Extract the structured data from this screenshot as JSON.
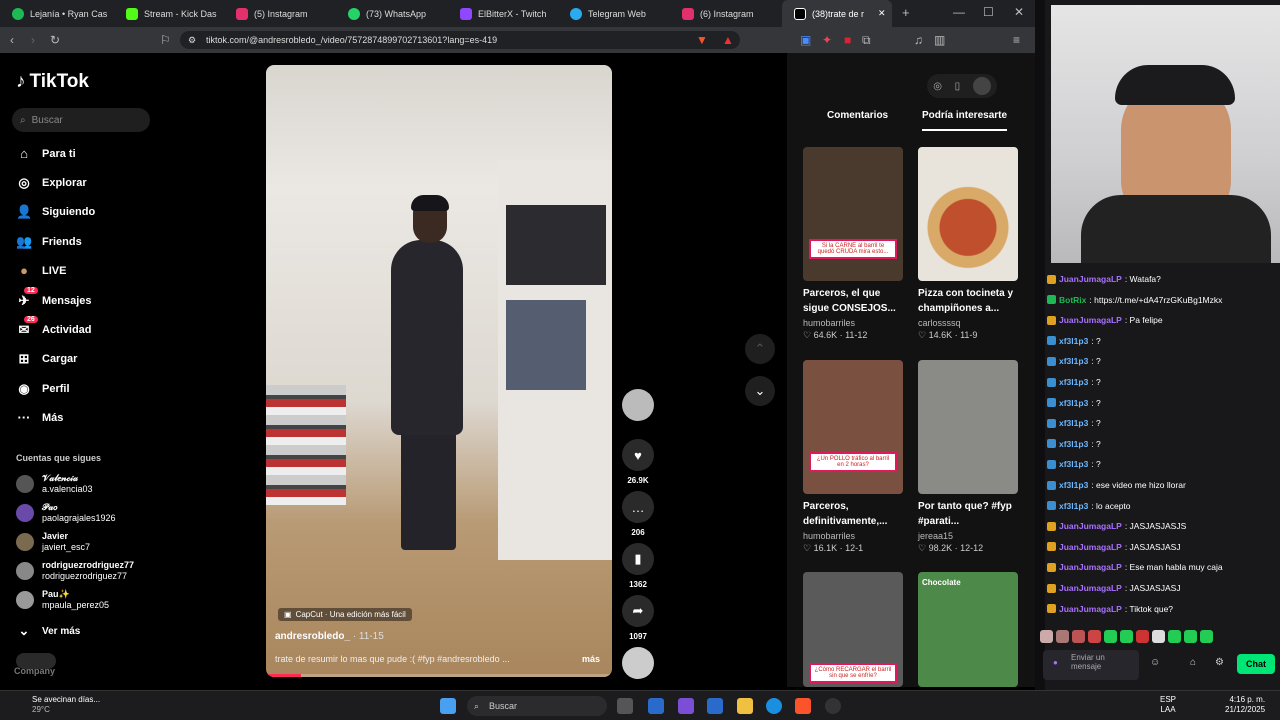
{
  "browser": {
    "tabs": [
      {
        "title": "Lejanía • Ryan Cas",
        "color": "#1db954"
      },
      {
        "title": "Stream - Kick Das",
        "color": "#53fc18"
      },
      {
        "title": "(5) Instagram",
        "color": "#e1306c"
      },
      {
        "title": "(73) WhatsApp",
        "color": "#25d366"
      },
      {
        "title": "ElBitterX - Twitch",
        "color": "#9147ff"
      },
      {
        "title": "Telegram Web",
        "color": "#2aabee"
      },
      {
        "title": "(6) Instagram",
        "color": "#e1306c"
      },
      {
        "title": "(38)trate de r",
        "color": "#fff"
      }
    ],
    "url": "tiktok.com/@andresrobledo_/video/7572874899702713601?lang=es-419"
  },
  "tiktok": {
    "logo": "TikTok",
    "search_placeholder": "Buscar",
    "nav": [
      {
        "label": "Para ti",
        "icon": "home-icon",
        "glyph": "⌂"
      },
      {
        "label": "Explorar",
        "icon": "compass-icon",
        "glyph": "◎"
      },
      {
        "label": "Siguiendo",
        "icon": "following-icon",
        "glyph": "👤"
      },
      {
        "label": "Friends",
        "icon": "friends-icon",
        "glyph": "👥"
      },
      {
        "label": "LIVE",
        "icon": "live-icon",
        "glyph": "●"
      },
      {
        "label": "Mensajes",
        "icon": "messages-icon",
        "glyph": "✈",
        "badge": "12"
      },
      {
        "label": "Actividad",
        "icon": "activity-icon",
        "glyph": "✉",
        "badge": "26"
      },
      {
        "label": "Cargar",
        "icon": "upload-icon",
        "glyph": "⊞"
      },
      {
        "label": "Perfil",
        "icon": "profile-icon",
        "glyph": "◉"
      },
      {
        "label": "Más",
        "icon": "more-icon",
        "glyph": "···"
      }
    ],
    "following_title": "Cuentas que sigues",
    "following": [
      {
        "name": "𝒱𝒶𝓁𝑒𝓃𝒸𝒾𝒶",
        "handle": "a.valencia03"
      },
      {
        "name": "𝒫𝒶𝑜",
        "handle": "paolagrajales1926"
      },
      {
        "name": "Javier",
        "handle": "javiert_esc7"
      },
      {
        "name": "rodriguezrodriguez77",
        "handle": "rodriguezrodriguez77"
      },
      {
        "name": "Pau✨",
        "handle": "mpaula_perez05"
      }
    ],
    "see_more": "Ver más",
    "company": "Company",
    "video": {
      "watermark": "CapCut · Una edición más fácil",
      "author": "andresrobledo_",
      "date": "· 11-15",
      "description": "trate de resumir lo mas que pude :( #fyp #andresrobledo ...",
      "more": "más",
      "progress": 0.1
    },
    "actions": {
      "likes": "26.9K",
      "comments": "206",
      "saves": "1362",
      "shares": "1097"
    },
    "right_tabs": [
      "Comentarios",
      "Podría interesarte"
    ],
    "cards": [
      {
        "title": "Parceros, el que sigue CONSEJOS...",
        "author": "humobarriles",
        "stats": "♡ 64.6K · 11-12",
        "caption": "Si la CARNE al barril te quedó CRUDA mira esto...",
        "bg": "#4a3a2e"
      },
      {
        "title": "Pizza con tocineta y champiñones a...",
        "author": "carlossssq",
        "stats": "♡ 14.6K · 11-9",
        "caption": "",
        "bg": "#c58b4a"
      },
      {
        "title": "Parceros, definitivamente,...",
        "author": "humobarriles",
        "stats": "♡ 16.1K · 12-1",
        "caption": "¿Un POLLO tráfico al barril en 2 horas?",
        "bg": "#7a5140"
      },
      {
        "title": "Por tanto que? #fyp #parati...",
        "author": "jereaa15",
        "stats": "♡ 98.2K · 12-12",
        "caption": "",
        "bg": "#8a8a86"
      },
      {
        "title": "",
        "author": "",
        "stats": "",
        "caption": "¿Cómo RECARGAR el barril sin que se enfríe?",
        "bg": "#5a5a5a"
      },
      {
        "title": "",
        "author": "",
        "stats": "",
        "caption": "Chocolate",
        "bg": "#4d8a4a"
      }
    ]
  },
  "twitch": {
    "messages": [
      {
        "user": "JuanJumagaLP",
        "text": ": Watafa?",
        "cls": "u1"
      },
      {
        "user": "BotRix",
        "text": ": https://t.me/+dA47rzGKuBg1Mzkx",
        "cls": "u4"
      },
      {
        "user": "JuanJumagaLP",
        "text": ": Pa felipe",
        "cls": "u1"
      },
      {
        "user": "xf3l1p3",
        "text": ": ?",
        "cls": "u3"
      },
      {
        "user": "xf3l1p3",
        "text": ": ?",
        "cls": "u3"
      },
      {
        "user": "xf3l1p3",
        "text": ": ?",
        "cls": "u3"
      },
      {
        "user": "xf3l1p3",
        "text": ": ?",
        "cls": "u3"
      },
      {
        "user": "xf3l1p3",
        "text": ": ?",
        "cls": "u3"
      },
      {
        "user": "xf3l1p3",
        "text": ": ?",
        "cls": "u3"
      },
      {
        "user": "xf3l1p3",
        "text": ": ?",
        "cls": "u3"
      },
      {
        "user": "xf3l1p3",
        "text": ": ese video me hizo llorar",
        "cls": "u3"
      },
      {
        "user": "xf3l1p3",
        "text": ": lo acepto",
        "cls": "u3"
      },
      {
        "user": "JuanJumagaLP",
        "text": ": JASJASJASJS",
        "cls": "u1"
      },
      {
        "user": "JuanJumagaLP",
        "text": ": JASJASJASJ",
        "cls": "u1"
      },
      {
        "user": "JuanJumagaLP",
        "text": ": Ese man habla muy caja",
        "cls": "u1"
      },
      {
        "user": "JuanJumagaLP",
        "text": ": JASJASJASJ",
        "cls": "u1"
      },
      {
        "user": "JuanJumagaLP",
        "text": ": Tiktok que?",
        "cls": "u1"
      }
    ],
    "input_placeholder": "Enviar un mensaje",
    "send": "Chat"
  },
  "taskbar": {
    "weather_text": "Se avecinan días...",
    "temp": "29°C",
    "search": "Buscar",
    "lang": "ESP",
    "lang2": "LAA",
    "time": "4:16 p. m.",
    "date": "21/12/2025"
  }
}
